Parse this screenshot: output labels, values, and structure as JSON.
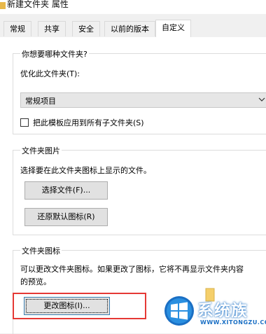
{
  "window": {
    "title": "新建文件夹 属性"
  },
  "tabs": [
    {
      "label": "常规"
    },
    {
      "label": "共享"
    },
    {
      "label": "安全"
    },
    {
      "label": "以前的版本"
    },
    {
      "label": "自定义",
      "active": true
    }
  ],
  "optimize_group": {
    "title": "你想要哪种文件夹?",
    "optimize_label": "优化此文件夹(T):",
    "selected_type": "常规项目",
    "apply_subfolders_label": "把此模板应用到所有子文件夹(S)",
    "apply_subfolders_checked": false
  },
  "picture_group": {
    "title": "文件夹图片",
    "description": "选择要在此文件夹图标上显示的文件。",
    "choose_file_button": "选择文件(F)...",
    "restore_default_button": "还原默认图标(R)"
  },
  "icon_group": {
    "title": "文件夹图标",
    "description_line1": "可以更改文件夹图标。如果更改了图标，它将不再显示文件夹内容",
    "description_line2": "的预览。",
    "change_icon_button": "更改图标(I)..."
  },
  "watermark": {
    "brand": "系统族",
    "url": "WWW.XITONGZU.COM"
  },
  "colors": {
    "highlight": "#e53935",
    "watermark_blue": "#1a6fc4"
  }
}
